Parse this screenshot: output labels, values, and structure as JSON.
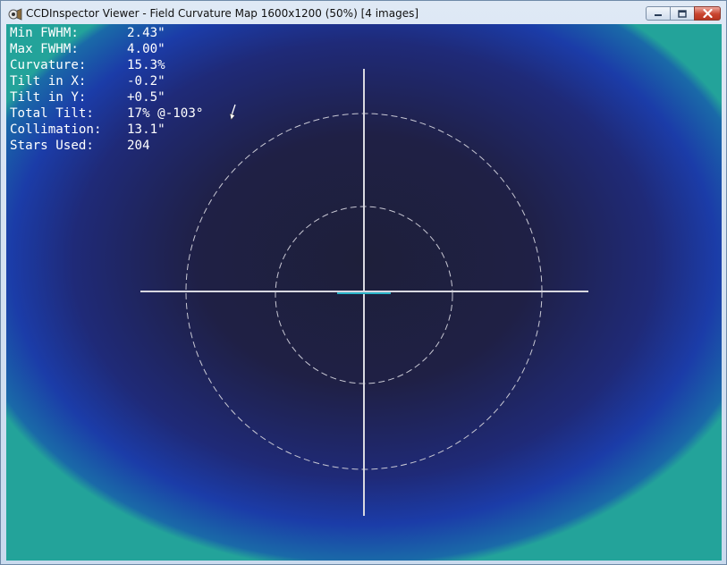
{
  "window": {
    "title": "CCDInspector Viewer - Field Curvature Map 1600x1200 (50%)  [4 images]",
    "app_icon": "ccdinspector-app-icon",
    "buttons": {
      "minimize_icon": "minimize-icon",
      "maximize_icon": "maximize-icon",
      "close_icon": "close-icon"
    }
  },
  "stats": [
    {
      "label": "Min FWHM:",
      "value": "2.43\""
    },
    {
      "label": "Max FWHM:",
      "value": "4.00\""
    },
    {
      "label": "Curvature:",
      "value": "15.3%"
    },
    {
      "label": "Tilt in X:",
      "value": "-0.2\""
    },
    {
      "label": "Tilt in Y:",
      "value": "+0.5\""
    },
    {
      "label": "Total Tilt:",
      "value": "17% @-103°"
    },
    {
      "label": "Collimation:",
      "value": "13.1\""
    },
    {
      "label": "Stars Used:",
      "value": "204"
    }
  ],
  "colors": {
    "crosshair": "#d8d8e0",
    "rings": "#c8c8d4",
    "tilt_indicator": "#2bb3c8",
    "map_center": "#1e1f3a",
    "map_edge": "#1b3ca8",
    "map_corner": "#23a39a"
  }
}
